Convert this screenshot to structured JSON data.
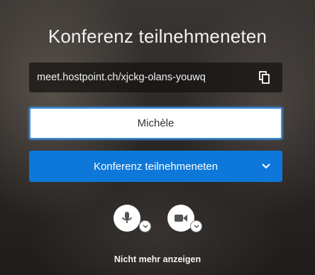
{
  "dialog": {
    "title": "Konferenz teilnehmeneten",
    "meeting_url": "meet.hostpoint.ch/xjckg-olans-youwq",
    "name_input": {
      "value": "Michèle",
      "placeholder": ""
    },
    "join_button_label": "Konferenz teilnehmeneten",
    "dont_show_again_label": "Nicht mehr anzeigen"
  },
  "icons": {
    "copy": "copy-icon",
    "dropdown": "chevron-down-icon",
    "microphone": "microphone-icon",
    "camera": "camera-icon"
  },
  "colors": {
    "accent": "#0d78da",
    "input_focus": "#3b8fe0"
  }
}
